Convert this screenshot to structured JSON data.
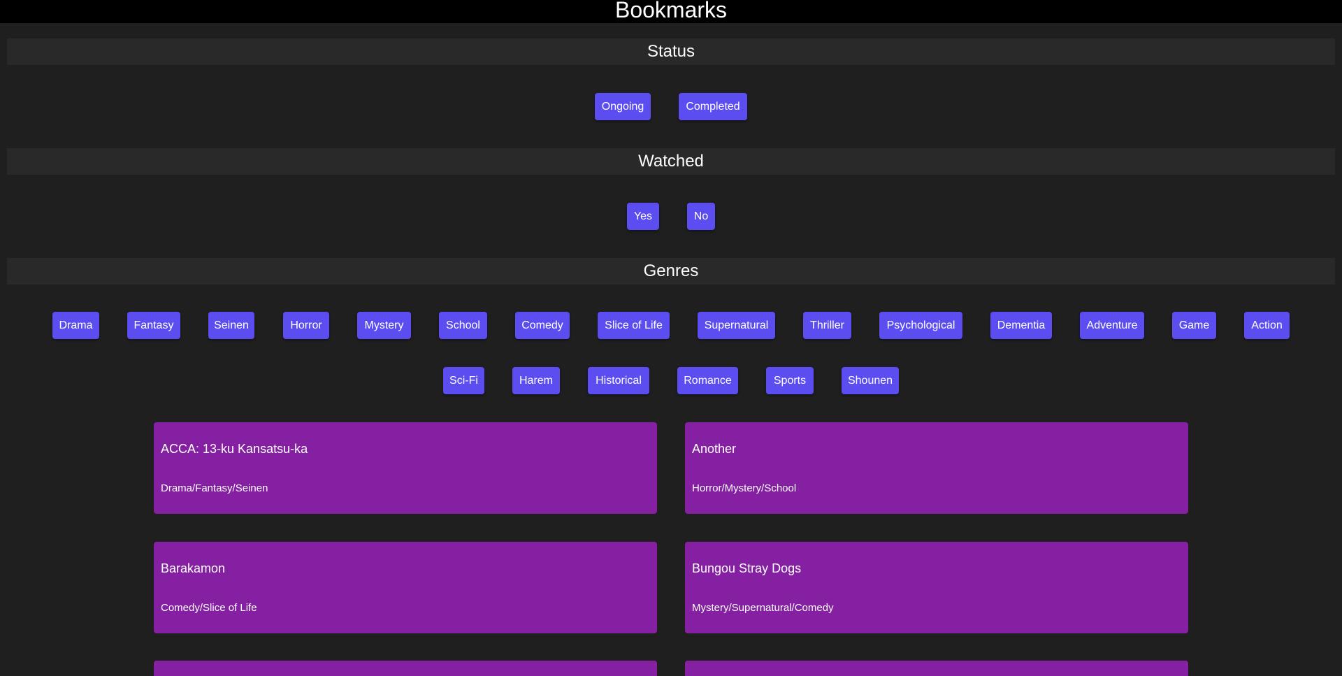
{
  "header": {
    "title": "Bookmarks"
  },
  "sections": {
    "status": {
      "title": "Status",
      "options": [
        "Ongoing",
        "Completed"
      ]
    },
    "watched": {
      "title": "Watched",
      "options": [
        "Yes",
        "No"
      ]
    },
    "genres": {
      "title": "Genres",
      "row1": [
        "Drama",
        "Fantasy",
        "Seinen",
        "Horror",
        "Mystery",
        "School",
        "Comedy",
        "Slice of Life",
        "Supernatural",
        "Thriller",
        "Psychological",
        "Dementia",
        "Adventure",
        "Game",
        "Action"
      ],
      "row2": [
        "Sci-Fi",
        "Harem",
        "Historical",
        "Romance",
        "Sports",
        "Shounen"
      ]
    }
  },
  "cards": [
    {
      "title": "ACCA: 13-ku Kansatsu-ka",
      "genres": "Drama/Fantasy/Seinen"
    },
    {
      "title": "Another",
      "genres": "Horror/Mystery/School"
    },
    {
      "title": "Barakamon",
      "genres": "Comedy/Slice of Life"
    },
    {
      "title": "Bungou Stray Dogs",
      "genres": "Mystery/Supernatural/Comedy"
    },
    {
      "title": "",
      "genres": ""
    },
    {
      "title": "",
      "genres": ""
    }
  ],
  "colors": {
    "background": "#1f1f1f",
    "header": "#000000",
    "section": "#292929",
    "button": "#5b4df0",
    "card": "#8420a1"
  }
}
